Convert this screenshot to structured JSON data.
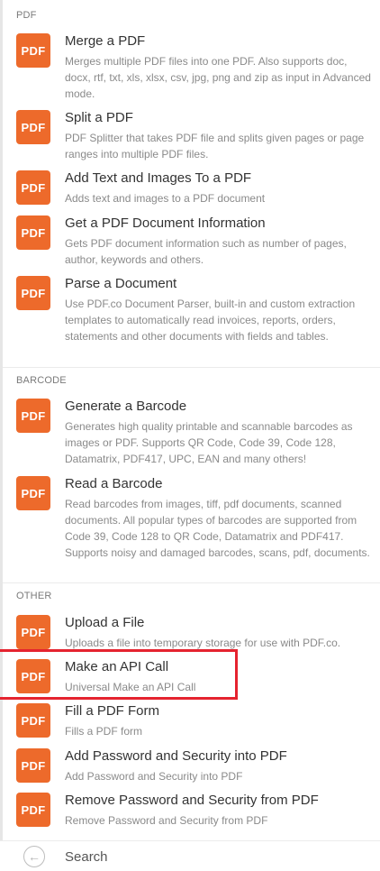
{
  "sections": [
    {
      "header": "PDF",
      "items": [
        {
          "title": "Merge a PDF",
          "desc": "Merges multiple PDF files into one PDF. Also supports doc, docx, rtf, txt, xls, xlsx, csv, jpg, png and zip as input in Advanced mode."
        },
        {
          "title": "Split a PDF",
          "desc": "PDF Splitter that takes PDF file and splits given pages or page ranges into multiple PDF files."
        },
        {
          "title": "Add Text and Images To a PDF",
          "desc": "Adds text and images to a PDF document"
        },
        {
          "title": "Get a PDF Document Information",
          "desc": "Gets PDF document information such as number of pages, author, keywords and others."
        },
        {
          "title": "Parse a Document",
          "desc": "Use PDF.co Document Parser, built-in and custom extraction templates to automatically read invoices, reports, orders, statements and other documents with fields and tables."
        }
      ]
    },
    {
      "header": "BARCODE",
      "items": [
        {
          "title": "Generate a Barcode",
          "desc": "Generates high quality printable and scannable barcodes as images or PDF. Supports QR Code, Code 39, Code 128, Datamatrix, PDF417, UPC, EAN and many others!"
        },
        {
          "title": "Read a Barcode",
          "desc": "Read barcodes from images, tiff, pdf documents, scanned documents. All popular types of barcodes are supported from Code 39, Code 128 to QR Code, Datamatrix and PDF417. Supports noisy and damaged barcodes, scans, pdf, documents."
        }
      ]
    },
    {
      "header": "OTHER",
      "items": [
        {
          "title": "Upload a File",
          "desc": "Uploads a file into temporary storage for use with PDF.co."
        },
        {
          "title": "Make an API Call",
          "desc": "Universal Make an API Call"
        },
        {
          "title": "Fill a PDF Form",
          "desc": "Fills a PDF form"
        },
        {
          "title": "Add Password and Security into PDF",
          "desc": "Add Password and Security into PDF"
        },
        {
          "title": "Remove Password and Security from PDF",
          "desc": "Remove Password and Security from PDF"
        }
      ]
    }
  ],
  "logo_text": "PDF",
  "search": {
    "placeholder": "Search"
  },
  "icons": {
    "back": "back-arrow-circle-icon",
    "app_logo": "pdf-co-logo-icon"
  },
  "colors": {
    "logo_bg": "#ed6a2b",
    "highlight": "#e5232f"
  }
}
